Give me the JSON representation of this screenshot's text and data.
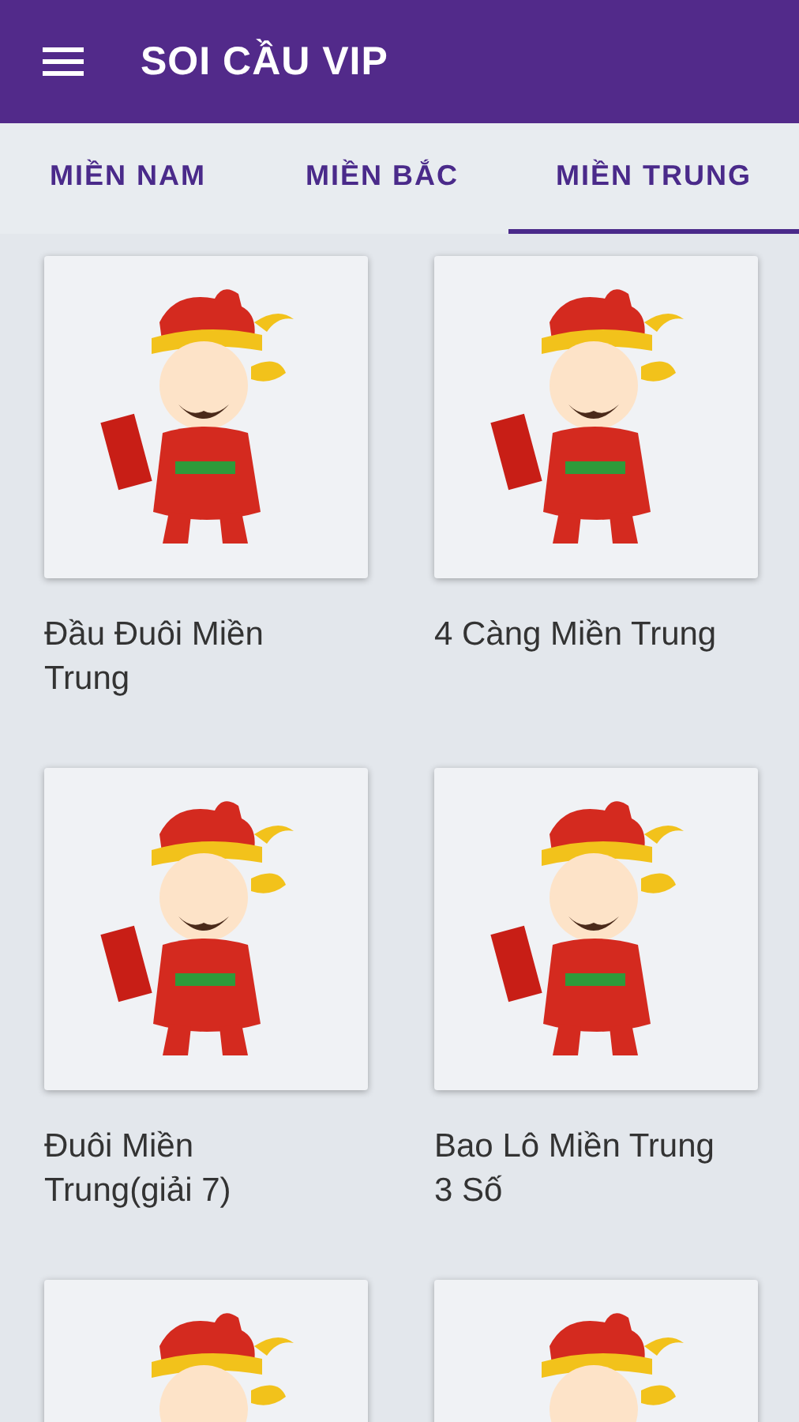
{
  "app_bar": {
    "title": "SOI CẦU VIP"
  },
  "tabs": [
    {
      "label": "MIỀN NAM",
      "selected": false
    },
    {
      "label": "MIỀN BẮC",
      "selected": false
    },
    {
      "label": "MIỀN TRUNG",
      "selected": true
    }
  ],
  "items": [
    {
      "kind": "tile",
      "label": "Đầu Đuôi Miền Trung"
    },
    {
      "kind": "tile",
      "label": "4 Càng Miền Trung"
    },
    {
      "kind": "tile",
      "label": "Đuôi Miền Trung(giải 7)"
    },
    {
      "kind": "tile",
      "label": "Bao Lô Miền Trung 3 Số"
    },
    {
      "kind": "tile"
    },
    {
      "kind": "tile"
    }
  ]
}
